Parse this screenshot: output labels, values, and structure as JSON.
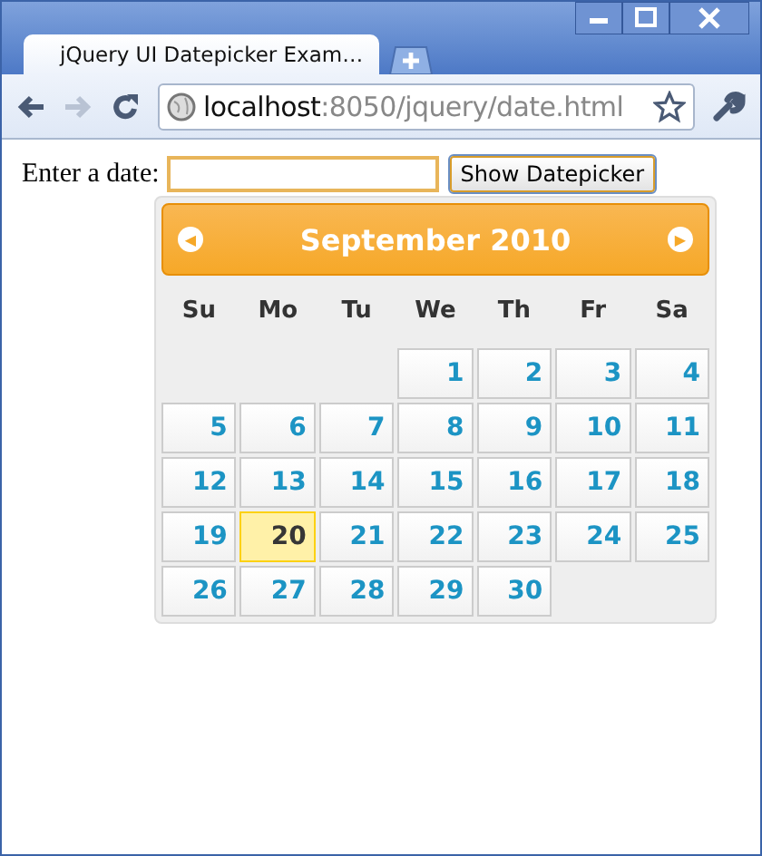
{
  "window": {
    "tab_title": "jQuery UI Datepicker Exam…"
  },
  "toolbar": {
    "address": {
      "host": "localhost",
      "path": ":8050/jquery/date.html"
    }
  },
  "page": {
    "label": "Enter a date:",
    "date_field": {
      "focused": true
    },
    "button": "Show Datepicker"
  },
  "datepicker": {
    "prev": "◀",
    "next": "▶",
    "month": "September 2010",
    "weekdays": [
      "Su",
      "Mo",
      "Tu",
      "We",
      "Th",
      "Fr",
      "Sa"
    ],
    "weeks": [
      [
        {
          "kind": "blank"
        },
        {
          "kind": "blank"
        },
        {
          "kind": "blank"
        },
        {
          "day": "1",
          "today": false
        },
        {
          "day": "2",
          "today": false
        },
        {
          "day": "3",
          "today": false
        },
        {
          "day": "4",
          "today": false
        }
      ],
      [
        {
          "day": "5",
          "today": false
        },
        {
          "day": "6",
          "today": false
        },
        {
          "day": "7",
          "today": false
        },
        {
          "day": "8",
          "today": false
        },
        {
          "day": "9",
          "today": false
        },
        {
          "day": "10",
          "today": false
        },
        {
          "day": "11",
          "today": false
        }
      ],
      [
        {
          "day": "12",
          "today": false
        },
        {
          "day": "13",
          "today": false
        },
        {
          "day": "14",
          "today": false
        },
        {
          "day": "15",
          "today": false
        },
        {
          "day": "16",
          "today": false
        },
        {
          "day": "17",
          "today": false
        },
        {
          "day": "18",
          "today": false
        }
      ],
      [
        {
          "day": "19",
          "today": false
        },
        {
          "day": "20",
          "today": true
        },
        {
          "day": "21",
          "today": false
        },
        {
          "day": "22",
          "today": false
        },
        {
          "day": "23",
          "today": false
        },
        {
          "day": "24",
          "today": false
        },
        {
          "day": "25",
          "today": false
        }
      ],
      [
        {
          "day": "26",
          "today": false
        },
        {
          "day": "27",
          "today": false
        },
        {
          "day": "28",
          "today": false
        },
        {
          "day": "29",
          "today": false
        },
        {
          "day": "30",
          "today": false
        },
        {
          "kind": "blank"
        },
        {
          "kind": "blank"
        }
      ]
    ]
  }
}
